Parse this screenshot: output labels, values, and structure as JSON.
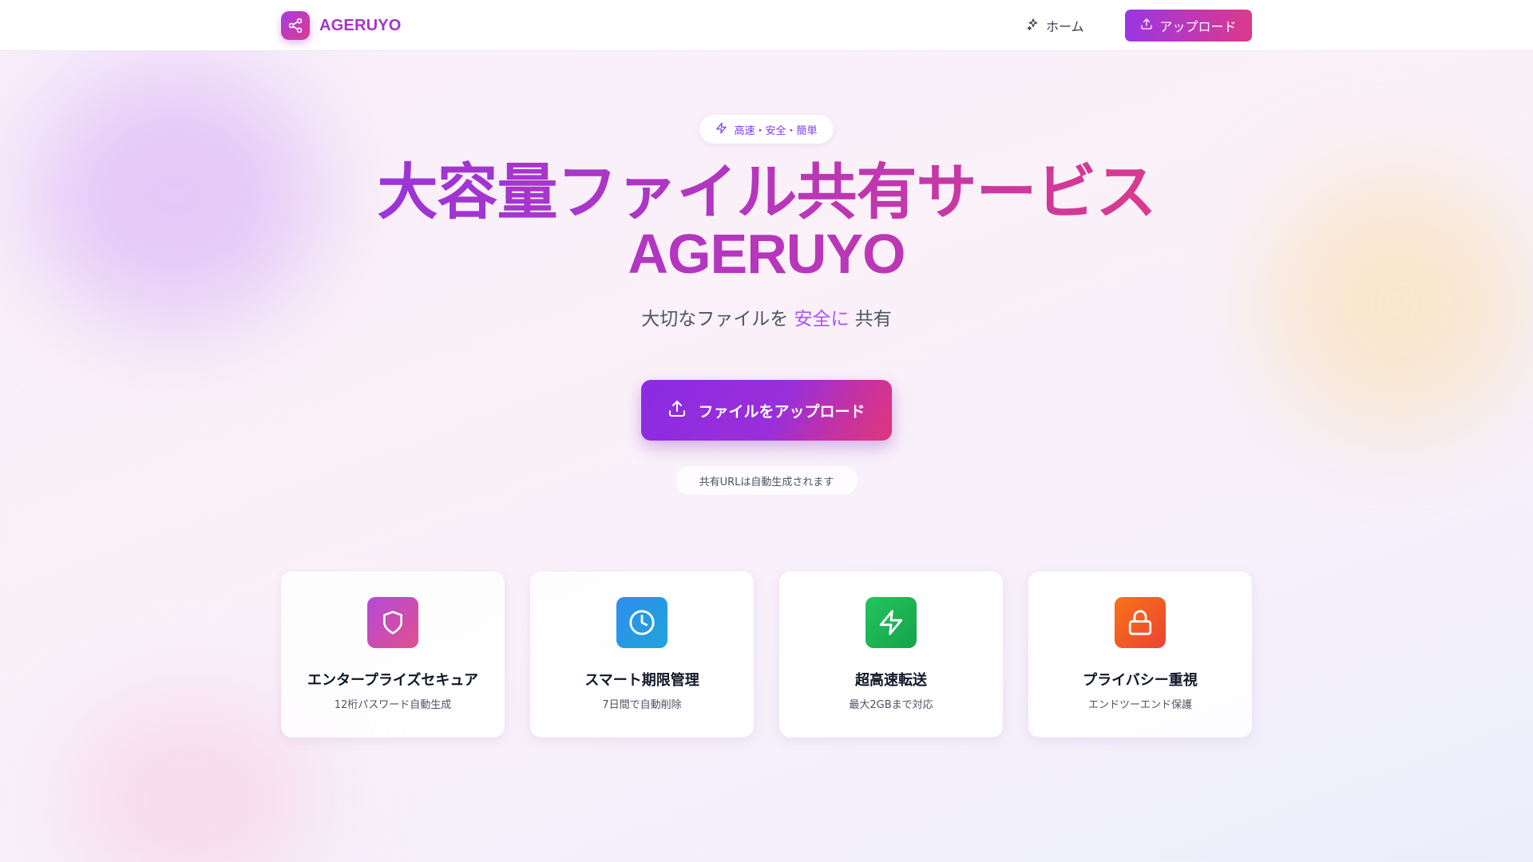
{
  "header": {
    "brand": "AGERUYO",
    "nav_home": "ホーム",
    "nav_upload": "アップロード"
  },
  "hero": {
    "badge": "高速・安全・簡単",
    "title_line1": "大容量ファイル共有サービス",
    "title_line2": "AGERUYO",
    "subtitle_pre": "大切なファイルを ",
    "subtitle_accent": "安全に",
    "subtitle_post": " 共有",
    "cta_label": "ファイルをアップロード",
    "note": "共有URLは自動生成されます"
  },
  "features": [
    {
      "title": "エンタープライズセキュア",
      "desc": "12桁パスワード自動生成",
      "icon": "shield-icon"
    },
    {
      "title": "スマート期限管理",
      "desc": "7日間で自動削除",
      "icon": "clock-icon"
    },
    {
      "title": "超高速転送",
      "desc": "最大2GBまで対応",
      "icon": "lightning-icon"
    },
    {
      "title": "プライバシー重視",
      "desc": "エンドツーエンド保護",
      "icon": "lock-icon"
    }
  ],
  "colors": {
    "brand_purple": "#9b35d6",
    "brand_pink": "#d93a8e",
    "accent": "#a855f7"
  }
}
